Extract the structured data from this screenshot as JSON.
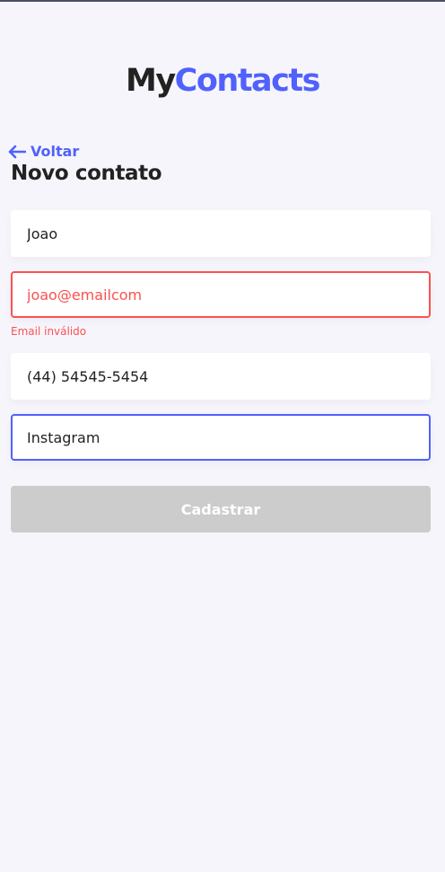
{
  "header": {
    "logo_part1": "My",
    "logo_part2": "Contacts"
  },
  "nav": {
    "back_label": "Voltar"
  },
  "page": {
    "title": "Novo contato"
  },
  "form": {
    "name_value": "Joao",
    "email_value": "joao@emailcom",
    "email_error": "Email inválido",
    "phone_value": "(44) 54545-5454",
    "category_value": "Instagram",
    "submit_label": "Cadastrar"
  },
  "colors": {
    "background": "#F6F5FC",
    "primary": "#5061FC",
    "error": "#FC5050",
    "disabled": "#CCCCCC",
    "text": "#222222"
  }
}
